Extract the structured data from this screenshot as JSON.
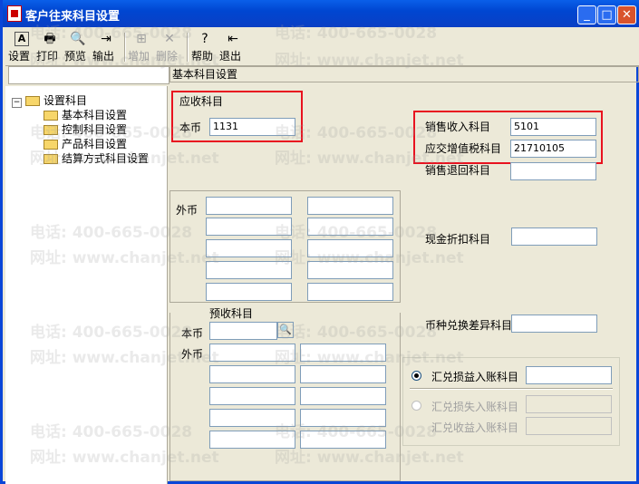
{
  "window": {
    "title": "客户往来科目设置",
    "minimize": "_",
    "maximize": "□",
    "close": "✕"
  },
  "toolbar": {
    "settings": "设置",
    "print": "打印",
    "preview": "预览",
    "export": "输出",
    "add": "增加",
    "delete": "删除",
    "help": "帮助",
    "exit": "退出"
  },
  "breadcrumb": "基本科目设置",
  "tree": {
    "root": "设置科目",
    "expander": "−",
    "items": [
      "基本科目设置",
      "控制科目设置",
      "产品科目设置",
      "结算方式科目设置"
    ]
  },
  "receivable": {
    "heading": "应收科目",
    "local_label": "本币",
    "local_value": "1131",
    "foreign_label": "外币"
  },
  "advance": {
    "heading": "预收科目",
    "local_label": "本币",
    "local_value": "",
    "foreign_label": "外币"
  },
  "right": {
    "sales_income_label": "销售收入科目",
    "sales_income_value": "5101",
    "vat_label": "应交增值税科目",
    "vat_value": "21710105",
    "sales_return_label": "销售退回科目",
    "sales_return_value": "",
    "cash_discount_label": "现金折扣科目",
    "cash_discount_value": "",
    "fx_diff_label": "币种兑换差异科目",
    "fx_diff_value": ""
  },
  "exchange": {
    "gain_loss_label": "汇兑损益入账科目",
    "loss_label": "汇兑损失入账科目",
    "income_label": "汇兑收益入账科目",
    "selected": "gain_loss"
  },
  "watermark": {
    "phone": "电话: 400-665-0028",
    "site": "网址: www.chanjet.net"
  },
  "colors": {
    "highlight": "#e8121f",
    "titlebar": "#0046d1"
  }
}
